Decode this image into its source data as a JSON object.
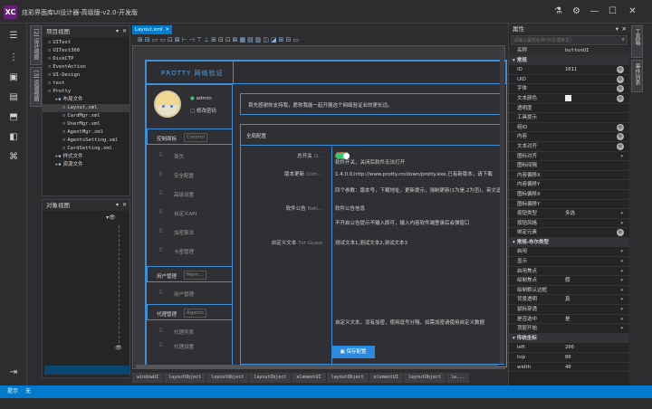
{
  "window": {
    "title": "炫彩界面库UI设计器-高级版-v2.0-开发版",
    "logo": "XC"
  },
  "document_tab": {
    "label": "Layout.xml"
  },
  "project_view": {
    "title": "项目视图",
    "items": [
      {
        "label": "UITest",
        "indent": 0
      },
      {
        "label": "UITest360",
        "indent": 0
      },
      {
        "label": "DiskCTP",
        "indent": 0
      },
      {
        "label": "EventAction",
        "indent": 0
      },
      {
        "label": "UI-Design",
        "indent": 0
      },
      {
        "label": "test",
        "indent": 0
      },
      {
        "label": "Protty",
        "indent": 0
      },
      {
        "label": "布局文件",
        "indent": 1
      },
      {
        "label": "Layout.xml",
        "indent": 2
      },
      {
        "label": "CardMgr.xml",
        "indent": 2
      },
      {
        "label": "UserMgr.xml",
        "indent": 2
      },
      {
        "label": "AgentMgr.xml",
        "indent": 2
      },
      {
        "label": "AgentsSetting.xml",
        "indent": 2
      },
      {
        "label": "CardSetting.xml",
        "indent": 2
      },
      {
        "label": "样式文件",
        "indent": 1
      },
      {
        "label": "资源文件",
        "indent": 1
      }
    ]
  },
  "object_view": {
    "title": "对象视图"
  },
  "left_side_tabs": [
    "[2] 设计视图",
    "[3] 资源视图"
  ],
  "right_side_tabs": [
    "工具箱",
    "事件列表"
  ],
  "canvas": {
    "brand": "PROTTY 网络验证",
    "user": {
      "name": "admin",
      "action": "修改密码"
    },
    "notice": "首先感谢你支持我，愿你我能一起开展这个网络验证业的更长远。",
    "menu_groups": [
      {
        "title": "控制面板",
        "tag": "Control",
        "items": [
          "首页",
          "安全配置",
          "高级设置",
          "自定义API",
          "加密算法",
          "卡密管理"
        ]
      },
      {
        "title": "用户管理",
        "tag": "Mem...",
        "items": [
          "用户管理"
        ]
      },
      {
        "title": "代理管理",
        "tag": "Agents",
        "items": [
          "代理列表",
          "代理设置"
        ]
      }
    ],
    "section_title": "全局配置",
    "rows": [
      {
        "label": "总开关",
        "sub": "O...",
        "content": "软件开关，关闭后软件无法打开"
      },
      {
        "label": "版本更新",
        "sub": "Com...",
        "content": "1.4.0.0,http://www.protty.cn/down/protty.exe,已有新版本，请下载"
      },
      {
        "label": "",
        "sub": "",
        "content": "四个参数：版本号，下载地址，更新提示，强制更新(1为是,2为否)，英文逗号分隔"
      },
      {
        "label": "软件公告",
        "sub": "Noti...",
        "content": "软件公告信息"
      },
      {
        "label": "",
        "sub": "",
        "content": "不开启公告提示不输入即可，输入内容软件端登录后会弹窗口"
      },
      {
        "label": "自定义文本",
        "sub": "Txt Guest",
        "content": "测试文本1,测试文本2,测试文本3"
      },
      {
        "label": "",
        "sub": "",
        "content": "自定义文本，没有加密，使用逗号分隔，如需加密请使用自定义数据"
      }
    ],
    "save_button": "保存配置"
  },
  "bottom_tabs": [
    "windowUI",
    "layoutObject",
    "layoutObject",
    "layoutObject",
    "elementUI",
    "layoutObject",
    "elementUI",
    "layoutObject",
    "la..."
  ],
  "status": {
    "label": "提示",
    "value": "无"
  },
  "properties": {
    "title": "属性",
    "search_placeholder": "请输入属性名称(中文或英文)",
    "header_name": "名称",
    "header_value": "buttonUI",
    "rows": [
      {
        "name": "常规",
        "value": "",
        "category": true
      },
      {
        "name": "ID",
        "value": "1011",
        "button": true
      },
      {
        "name": "UID",
        "value": "",
        "button": true
      },
      {
        "name": "字体",
        "value": "",
        "button": true
      },
      {
        "name": "文本颜色",
        "value": "",
        "swatch": true,
        "button": true
      },
      {
        "name": "透明度",
        "value": ""
      },
      {
        "name": "工具提示",
        "value": ""
      },
      {
        "name": "组ID",
        "value": "",
        "button": true
      },
      {
        "name": "内容",
        "value": "",
        "button": true
      },
      {
        "name": "文本对齐",
        "value": "",
        "button": true
      },
      {
        "name": "图标对齐",
        "value": "",
        "dropdown": true
      },
      {
        "name": "图标间隔",
        "value": ""
      },
      {
        "name": "内容偏移X",
        "value": ""
      },
      {
        "name": "内容偏移Y",
        "value": ""
      },
      {
        "name": "图标偏移X",
        "value": ""
      },
      {
        "name": "图标偏移Y",
        "value": ""
      },
      {
        "name": "按钮类型",
        "value": "多选",
        "dropdown": true
      },
      {
        "name": "按钮风格",
        "value": "",
        "dropdown": true
      },
      {
        "name": "绑定元素",
        "value": "",
        "button": true
      },
      {
        "name": "常规-布尔类型",
        "value": "",
        "category": true
      },
      {
        "name": "启用",
        "value": "",
        "dropdown": true
      },
      {
        "name": "显示",
        "value": "",
        "dropdown": true
      },
      {
        "name": "启用焦点",
        "value": "",
        "dropdown": true
      },
      {
        "name": "绘制焦点",
        "value": "假",
        "dropdown": true
      },
      {
        "name": "绘制默认边框",
        "value": "",
        "dropdown": true
      },
      {
        "name": "背景透明",
        "value": "真",
        "dropdown": true
      },
      {
        "name": "鼠标穿透",
        "value": "",
        "dropdown": true
      },
      {
        "name": "是否选中",
        "value": "是",
        "dropdown": true
      },
      {
        "name": "顶层开始",
        "value": "",
        "dropdown": true
      },
      {
        "name": "传统坐标",
        "value": "",
        "category": true
      },
      {
        "name": "left",
        "value": "206"
      },
      {
        "name": "top",
        "value": "80"
      },
      {
        "name": "width",
        "value": "40"
      }
    ]
  },
  "colors": {
    "accent": "#007acc",
    "selection": "#094771",
    "canvas_border": "#3d8fd8",
    "toggle_on": "#2ecc71"
  }
}
